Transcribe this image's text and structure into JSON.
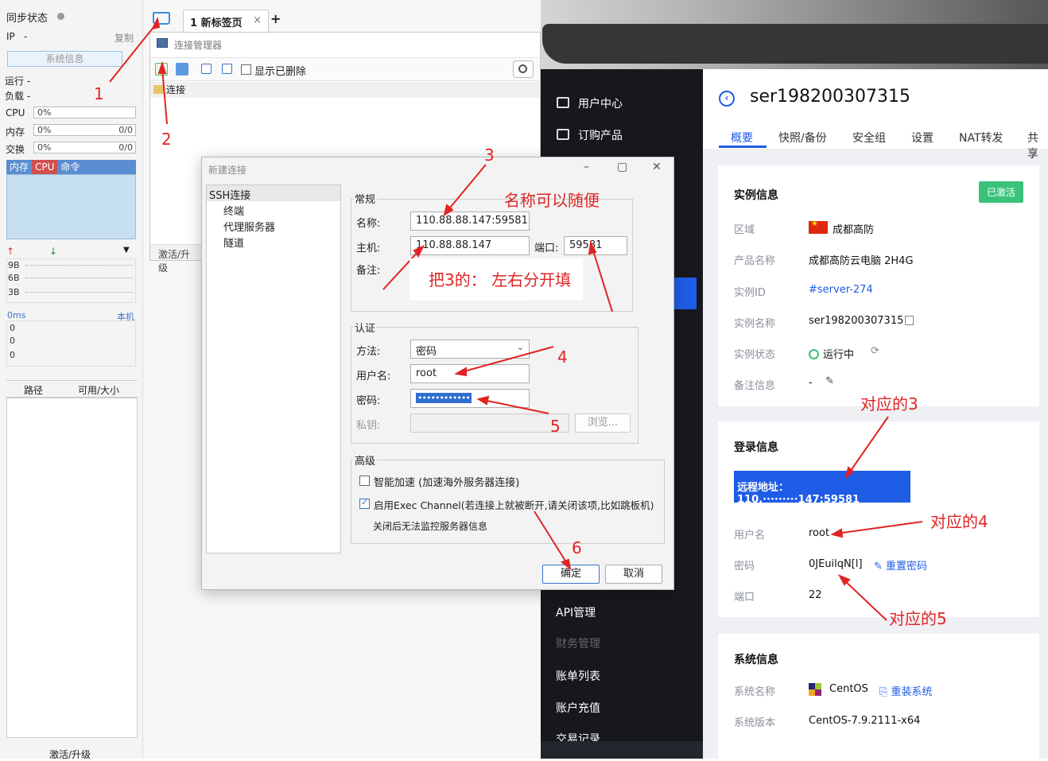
{
  "left_monitor": {
    "sync_status": "同步状态",
    "ip_label": "IP",
    "ip_value": "-",
    "copy": "复制",
    "sysinfo_button": "系统信息",
    "running_label": "运行 -",
    "load_label": "负载 -",
    "cpu_label": "CPU",
    "cpu_value": "0%",
    "mem_label": "内存",
    "mem_value": "0%",
    "mem_ratio": "0/0",
    "swap_label": "交换",
    "swap_value": "0%",
    "swap_ratio": "0/0",
    "tabs": [
      "内存",
      "CPU",
      "命令"
    ],
    "net_labels": [
      "9B",
      "6B",
      "3B"
    ],
    "latency_label": "0ms",
    "latency_local": "本机",
    "latency_values": [
      "0",
      "0",
      "0"
    ],
    "col_path": "路径",
    "col_avail": "可用/大小",
    "activate": "激活/升级"
  },
  "terminal": {
    "tab_label": "1 新标签页",
    "tab_close": "×",
    "tab_add": "+",
    "conn_manager_title": "连接管理器",
    "show_deleted": "显示已删除",
    "tree_root": "连接",
    "activate": "激活/升级"
  },
  "dialog": {
    "title": "新建连接",
    "tree": {
      "ssh": "SSH连接",
      "terminal": "终端",
      "proxy": "代理服务器",
      "tunnel": "隧道"
    },
    "general_group": "常规",
    "name_label": "名称:",
    "name_value": "110.88.88.147:59581",
    "host_label": "主机:",
    "host_value": "110.88.88.147",
    "port_label": "端口:",
    "port_value": "59581",
    "note_label": "备注:",
    "auth_group": "认证",
    "method_label": "方法:",
    "method_value": "密码",
    "user_label": "用户名:",
    "user_value": "root",
    "pass_label": "密码:",
    "pass_value": "••••••••••••",
    "key_label": "私钥:",
    "browse": "浏览...",
    "advanced_group": "高级",
    "smart_accel": "智能加速 (加速海外服务器连接)",
    "exec_channel": "启用Exec Channel(若连接上就被断开,请关闭该项,比如跳板机)",
    "exec_note": "关闭后无法监控服务器信息",
    "ok": "确定",
    "cancel": "取消"
  },
  "console": {
    "nav": {
      "user_center": "用户中心",
      "order": "订购产品",
      "api": "API管理",
      "finance": "财务管理",
      "bills": "账单列表",
      "recharge": "账户充值",
      "trade": "交易记录"
    },
    "title": "ser198200307315",
    "back_icon": "‹",
    "tabs": [
      "概要",
      "快照/备份",
      "安全组",
      "设置",
      "NAT转发",
      "共享"
    ],
    "instance": {
      "heading": "实例信息",
      "status_badge": "已激活",
      "region_k": "区域",
      "region_v": "成都高防",
      "product_k": "产品名称",
      "product_v": "成都高防云电脑 2H4G",
      "id_k": "实例ID",
      "id_v": "#server-274",
      "name_k": "实例名称",
      "name_v": "ser198200307315",
      "state_k": "实例状态",
      "state_v": "运行中",
      "note_k": "备注信息",
      "note_v": "-"
    },
    "login": {
      "heading": "登录信息",
      "remote_label": "远程地址：",
      "remote_value": "110.·········147:59581",
      "user_k": "用户名",
      "user_v": "root",
      "pass_k": "密码",
      "pass_v": "0JEuilqN[l]",
      "reset": "重置密码",
      "port_k": "端口",
      "port_v": "22"
    },
    "system": {
      "heading": "系统信息",
      "os_k": "系统名称",
      "os_v": "CentOS",
      "reinstall": "重装系统",
      "ver_k": "系统版本",
      "ver_v": "CentOS-7.9.2111-x64"
    }
  },
  "annotations": {
    "a1": "1",
    "a2": "2",
    "a3": "3",
    "a4": "4",
    "a5": "5",
    "a6": "6",
    "name_free": "名称可以随便",
    "split_hint": "把3的： 左右分开填",
    "map3": "对应的3",
    "map4": "对应的4",
    "map5": "对应的5"
  },
  "colors": {
    "accent_blue": "#1f5ce6",
    "annotation_red": "#e02424",
    "status_green": "#3ac27b",
    "nav_dark": "#16181d"
  }
}
